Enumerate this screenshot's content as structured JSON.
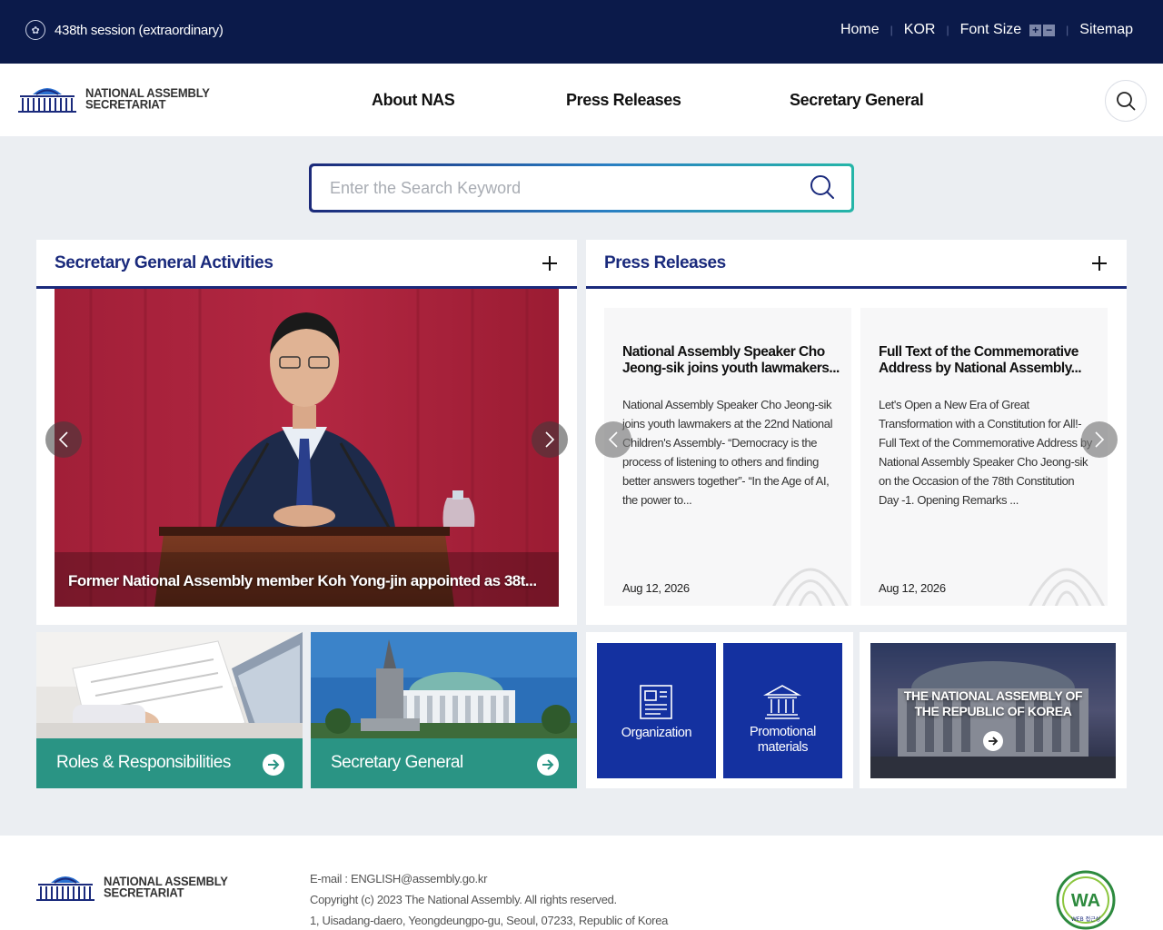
{
  "topbar": {
    "session": "438th session (extraordinary)",
    "links": {
      "home": "Home",
      "kor": "KOR",
      "font_size": "Font Size",
      "sitemap": "Sitemap"
    },
    "font_plus": "+",
    "font_minus": "−"
  },
  "header": {
    "logo_line1": "NATIONAL ASSEMBLY",
    "logo_line2": "SECRETARIAT",
    "nav": [
      "About NAS",
      "Press Releases",
      "Secretary General"
    ]
  },
  "search": {
    "placeholder": "Enter the Search Keyword"
  },
  "sg_activities": {
    "title": "Secretary General Activities",
    "caption": "Former National Assembly member Koh Yong-jin appointed as 38t..."
  },
  "press": {
    "title": "Press Releases",
    "cards": [
      {
        "title": "National Assembly Speaker Cho Jeong-sik joins youth lawmakers...",
        "body": "National Assembly Speaker Cho Jeong-sik joins youth lawmakers at the 22nd National Children's Assembly- “Democracy is the process of listening to others and finding better answers together”- “In the Age of AI, the power to...",
        "date": "Aug 12, 2026"
      },
      {
        "title": "Full Text of the Commemorative Address by National Assembly...",
        "body": "Let's Open a New Era of Great Transformation with a Constitution for All!- Full Text of the Commemorative Address by National Assembly Speaker Cho Jeong-sik on the Occasion of the 78th Constitution Day -1. Opening Remarks ...",
        "date": "Aug 12, 2026"
      }
    ]
  },
  "tiles": {
    "roles": "Roles & Responsibilities",
    "secretary": "Secretary General"
  },
  "quick": {
    "organization": "Organization",
    "promo_line1": "Promotional",
    "promo_line2": "materials"
  },
  "nak": {
    "line1": "THE NATIONAL ASSEMBLY OF",
    "line2": "THE REPUBLIC OF KOREA"
  },
  "footer": {
    "logo_line1": "NATIONAL ASSEMBLY",
    "logo_line2": "SECRETARIAT",
    "email": "E-mail : ENGLISH@assembly.go.kr",
    "copyright": "Copyright (c) 2023 The National Assembly. All rights reserved.",
    "address": "1, Uisadang-daero, Yeongdeungpo-gu, Seoul, 07233, Republic of Korea",
    "wa_mark": "WA",
    "wa_caption": "WEB 접근성"
  },
  "colors": {
    "topbar": "#0b1a4a",
    "accent_navy": "#1a2a7c",
    "teal": "#2a9484",
    "quick_blue": "#1431a0"
  }
}
